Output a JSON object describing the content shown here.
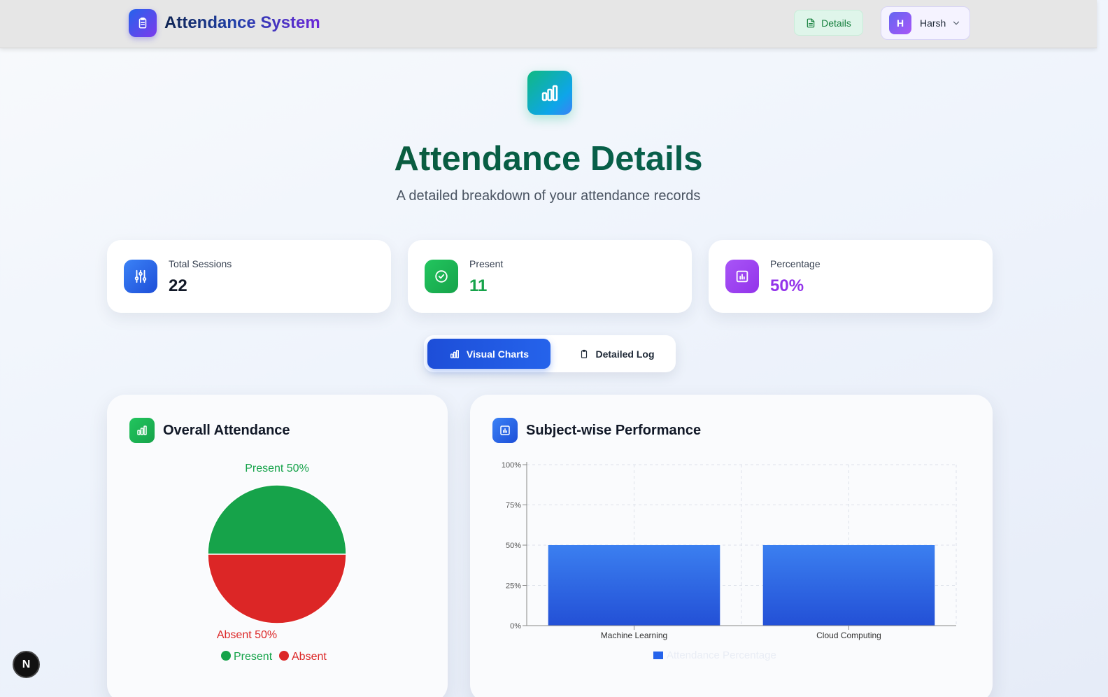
{
  "navbar": {
    "app_title": "Attendance System",
    "details_label": "Details",
    "user": {
      "initial": "H",
      "name": "Harsh"
    }
  },
  "hero": {
    "title": "Attendance Details",
    "subtitle": "A detailed breakdown of your attendance records"
  },
  "stats": [
    {
      "label": "Total Sessions",
      "value": "22",
      "color": "#111827",
      "icon": "sliders-icon"
    },
    {
      "label": "Present",
      "value": "11",
      "color": "#16a34a",
      "icon": "check-circle-icon"
    },
    {
      "label": "Percentage",
      "value": "50%",
      "color": "#9333ea",
      "icon": "report-chart-icon"
    }
  ],
  "tabs": {
    "visual_charts": "Visual Charts",
    "detailed_log": "Detailed Log"
  },
  "overall_panel": {
    "title": "Overall Attendance",
    "present_label": "Present 50%",
    "absent_label": "Absent 50%",
    "legend": [
      "Present",
      "Absent"
    ]
  },
  "subject_panel": {
    "title": "Subject-wise Performance",
    "legend": "Attendance Percentage"
  },
  "badge": {
    "letter": "N"
  },
  "colors": {
    "present": "#16a34a",
    "absent": "#dc2626",
    "bar": "#2f6de6",
    "accent_blue": "#2563eb",
    "accent_purple": "#9333ea"
  },
  "chart_data": [
    {
      "type": "pie",
      "title": "Overall Attendance",
      "categories": [
        "Present",
        "Absent"
      ],
      "values": [
        50,
        50
      ],
      "colors": [
        "#16a34a",
        "#dc2626"
      ]
    },
    {
      "type": "bar",
      "title": "Subject-wise Performance",
      "categories": [
        "Machine Learning",
        "Cloud Computing"
      ],
      "series": [
        {
          "name": "Attendance Percentage",
          "values": [
            50,
            50
          ]
        }
      ],
      "yticks": [
        "0%",
        "25%",
        "50%",
        "75%",
        "100%"
      ],
      "ylim": [
        0,
        100
      ],
      "grid": true,
      "legend": "bottom"
    }
  ]
}
